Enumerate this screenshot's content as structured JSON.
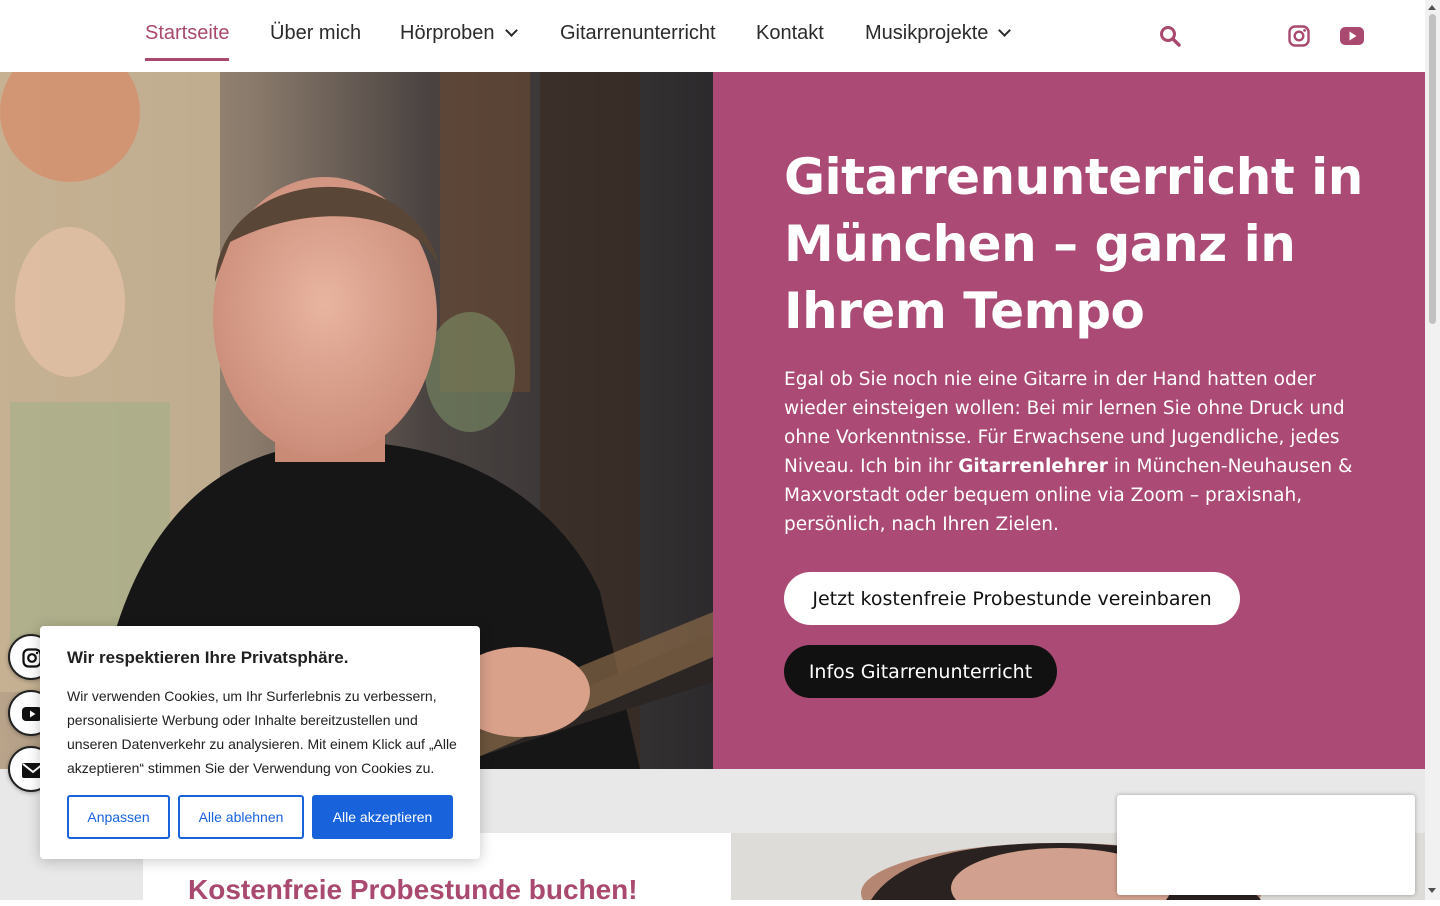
{
  "nav": {
    "items": [
      {
        "label": "Startseite",
        "active": true
      },
      {
        "label": "Über mich"
      },
      {
        "label": "Hörproben",
        "dropdown": true
      },
      {
        "label": "Gitarrenunterricht"
      },
      {
        "label": "Kontakt"
      },
      {
        "label": "Musikprojekte",
        "dropdown": true
      }
    ],
    "icons": [
      "search-icon",
      "instagram-icon",
      "youtube-icon"
    ]
  },
  "hero": {
    "title": "Gitarrenunterricht in München – ganz in Ihrem Tempo",
    "body_before": "Egal ob Sie noch nie eine Gitarre in der Hand hatten oder wieder einsteigen wollen: Bei mir lernen Sie ohne Druck und ohne Vorkenntnisse. Für Erwachsene und Jugendliche, jedes Niveau. Ich bin ihr ",
    "body_bold": "Gitarrenlehrer",
    "body_after": " in München-Neuhausen & Maxvorstadt oder bequem online via Zoom – praxisnah, persönlich, nach Ihren Zielen.",
    "cta_primary": "Jetzt kostenfreie Probestunde vereinbaren",
    "cta_secondary": "Infos Gitarrenunterricht"
  },
  "section": {
    "heading": "Kostenfreie Probestunde buchen!"
  },
  "floating_social": [
    "instagram-icon",
    "youtube-icon",
    "envelope-icon"
  ],
  "cookie": {
    "title": "Wir respektieren Ihre Privatsphäre.",
    "text": "Wir verwenden Cookies, um Ihr Surferlebnis zu verbessern, personalisierte Werbung oder Inhalte bereitzustellen und unseren Datenverkehr zu analysieren. Mit einem Klick auf „Alle akzeptieren“ stimmen Sie der Verwendung von Cookies zu.",
    "btn_customize": "Anpassen",
    "btn_reject": "Alle ablehnen",
    "btn_accept": "Alle akzeptieren"
  },
  "colors": {
    "brand": "#ab4a74",
    "accent_text": "#a9496f",
    "cookie_blue": "#1863dc"
  }
}
